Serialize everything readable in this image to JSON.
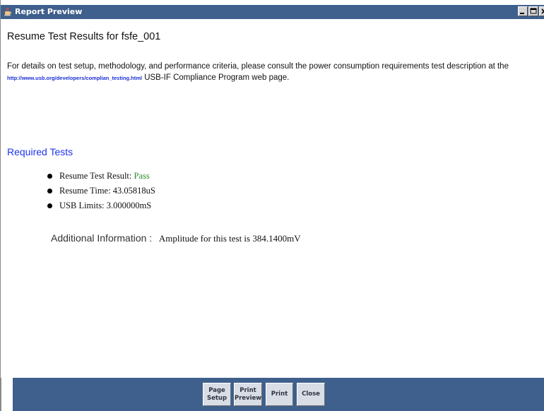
{
  "window": {
    "title": "Report Preview"
  },
  "report": {
    "title": "Resume Test Results for fsfe_001",
    "intro_before_link": "For details on test setup, methodology, and performance criteria, please consult the power consumption requirements test description at the ",
    "link": "http://www.usb.org/developers/complian_testing.html",
    "intro_after_link": " USB-IF Compliance Program web page.",
    "section_heading": "Required Tests",
    "results": [
      {
        "label": "Resume Test Result: ",
        "value": "Pass"
      },
      {
        "label": "Resume Time: ",
        "value": "43.05818uS"
      },
      {
        "label": "USB Limits: ",
        "value": "3.000000mS"
      }
    ],
    "additional_label": "Additional Information :",
    "additional_value": "Amplitude for this test is 384.1400mV"
  },
  "buttons": {
    "page_setup": "Page Setup",
    "print_preview": "Print Preview",
    "print": "Print",
    "close": "Close"
  },
  "colors": {
    "titlebar": "#3f5f8c",
    "link": "#1a2fd6",
    "heading": "#1e34ee",
    "pass": "#2f8b2f"
  }
}
